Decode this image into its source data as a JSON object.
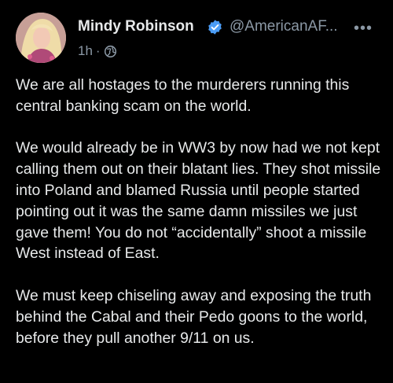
{
  "author": {
    "name": "Mindy Robinson",
    "handle": "@AmericanAF...",
    "time": "1h",
    "separator": "·",
    "verified_color": "#4b9cf5"
  },
  "icons": {
    "avatar": "profile-photo",
    "verified": "verified-badge-icon",
    "visibility": "globe-icon",
    "menu": "more-dots-icon"
  },
  "menu_label": "•••",
  "post": {
    "paragraphs": [
      "We are all hostages to the murderers running this central banking scam on the world.",
      "We would already be in WW3 by now had we not kept calling them out on their blatant lies. They shot missile into Poland and blamed Russia until people started pointing out it was the same damn missiles we just gave them! You do not “accidentally” shoot a missile West instead of East.",
      "We must keep chiseling away and exposing the truth behind the Cabal and their Pedo goons to the world, before they pull another 9/11 on us."
    ]
  }
}
